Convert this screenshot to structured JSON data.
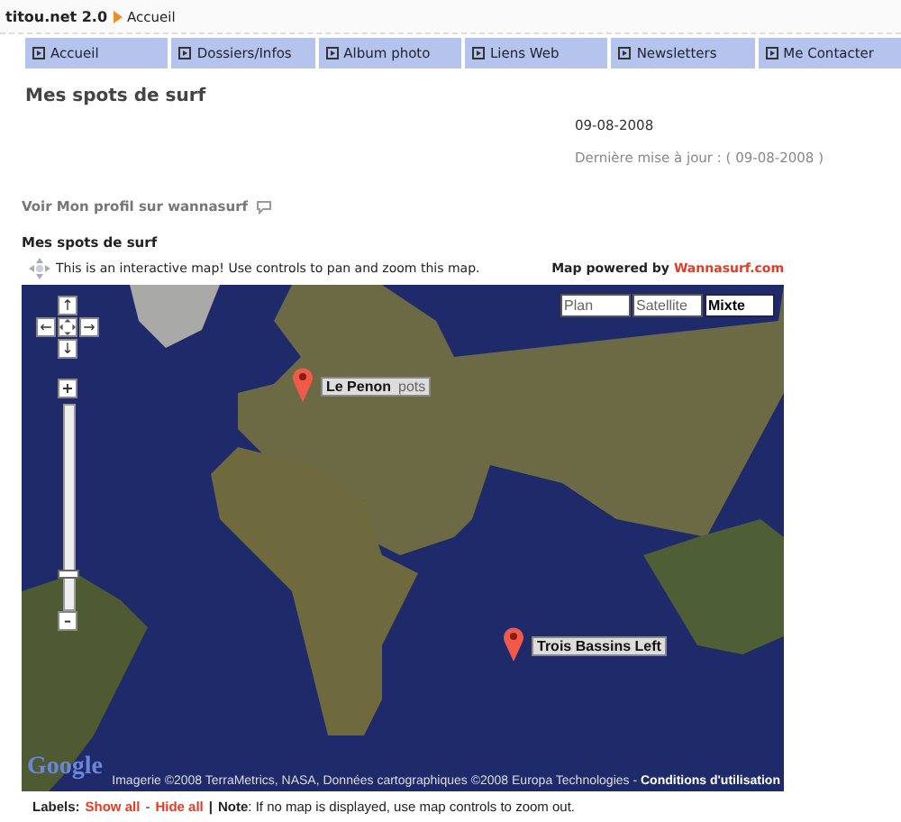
{
  "breadcrumb": {
    "site": "titou.net 2.0",
    "current": "Accueil"
  },
  "nav": [
    {
      "label": "Accueil"
    },
    {
      "label": "Dossiers/Infos"
    },
    {
      "label": "Album photo"
    },
    {
      "label": "Liens Web"
    },
    {
      "label": "Newsletters"
    },
    {
      "label": "Me Contacter"
    }
  ],
  "page_title": "Mes spots de surf",
  "date": "09-08-2008",
  "updated": "Dernière mise à jour : ( 09-08-2008 )",
  "profile_link": "Voir Mon profil sur wannasurf",
  "section_title": "Mes spots de surf",
  "map_hint": "This is an interactive map! Use controls to pan and zoom this map.",
  "powered": {
    "text": "Map powered by",
    "link": "Wannasurf.com"
  },
  "map": {
    "types": [
      {
        "label": "Plan",
        "selected": false
      },
      {
        "label": "Satellite",
        "selected": false
      },
      {
        "label": "Mixte",
        "selected": true
      }
    ],
    "pan": {
      "up": "↑",
      "left": "←",
      "right": "→",
      "down": "↓"
    },
    "zoom": {
      "plus": "+",
      "minus": "–",
      "level": 0.15
    },
    "markers": [
      {
        "label": "Le Penon",
        "behind": "pots"
      },
      {
        "label": "Trois Bassins Left"
      }
    ],
    "logo": "Google",
    "copyright": "Imagerie ©2008 TerraMetrics, NASA, Données cartographiques ©2008 Europa Technologies - ",
    "terms": "Conditions d'utilisation"
  },
  "footer": {
    "labels": "Labels:",
    "show_all": "Show all",
    "sep": "-",
    "hide_all": "Hide all",
    "bar": "|",
    "note": "**Note**: If no map is displayed, use map controls to zoom out."
  }
}
